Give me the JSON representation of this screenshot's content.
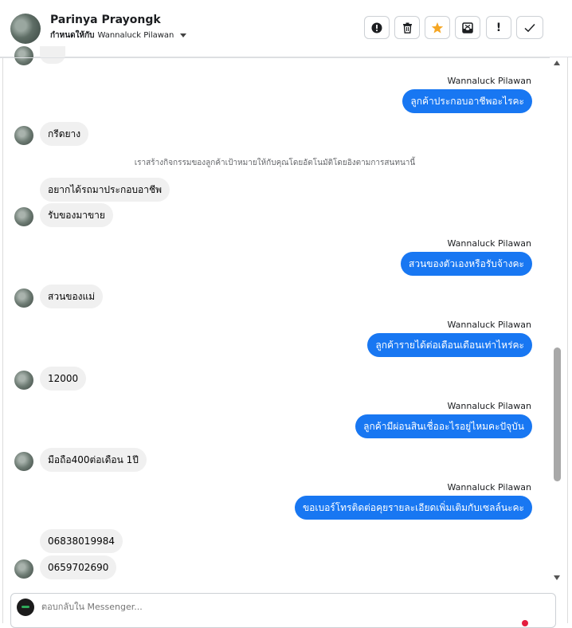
{
  "header": {
    "contact_name": "Parinya Prayongk",
    "assign_label": "กำหนดให้กับ",
    "assignee": "Wannaluck Pilawan",
    "actions": [
      {
        "icon": "alert-circle-icon",
        "glyph": "❗"
      },
      {
        "icon": "trash-icon",
        "glyph": "🗑"
      },
      {
        "icon": "star-icon",
        "glyph": "★"
      },
      {
        "icon": "inbox-icon",
        "glyph": "⊠"
      },
      {
        "icon": "exclamation-icon",
        "glyph": "!"
      },
      {
        "icon": "check-icon",
        "glyph": "✓"
      }
    ]
  },
  "colors": {
    "accent": "#1877f2",
    "star": "#f5a623",
    "incoming_bubble": "#f0f0f0"
  },
  "messages": [
    {
      "type": "outgoing",
      "sender": "Wannaluck Pilawan",
      "text": "ลูกค้าประกอบอาชีพอะไรคะ"
    },
    {
      "type": "incoming",
      "text": "กรีดยาง"
    },
    {
      "type": "system",
      "text": "เราสร้างกิจกรรมของลูกค้าเป้าหมายให้กับคุณโดยอัตโนมัติโดยอิงตามการสนทนานี้"
    },
    {
      "type": "incoming",
      "text": "อยากได้รถมาประกอบอาชีพ"
    },
    {
      "type": "incoming",
      "text": "รับของมาขาย"
    },
    {
      "type": "outgoing",
      "sender": "Wannaluck Pilawan",
      "text": "สวนของตัวเองหรือรับจ้างคะ"
    },
    {
      "type": "incoming",
      "text": "สวนของแม่"
    },
    {
      "type": "outgoing",
      "sender": "Wannaluck Pilawan",
      "text": "ลูกค้ารายได้ต่อเดือนเดือนเท่าไหร่คะ"
    },
    {
      "type": "incoming",
      "text": "12000"
    },
    {
      "type": "outgoing",
      "sender": "Wannaluck Pilawan",
      "text": "ลูกค้ามีผ่อนสินเชื่ออะไรอยู่ไหมคะปัจุบัน"
    },
    {
      "type": "incoming",
      "text": "มือถือ400ต่อเดือน 1ปี"
    },
    {
      "type": "outgoing",
      "sender": "Wannaluck Pilawan",
      "text": "ขอเบอร์โทรติดต่อคุยรายละเอียดเพิ่มเติมกับเซลล์นะคะ"
    },
    {
      "type": "incoming",
      "text": "06838019984"
    },
    {
      "type": "incoming",
      "text": "0659702690"
    }
  ],
  "composer": {
    "placeholder": "ตอบกลับใน Messenger..."
  }
}
